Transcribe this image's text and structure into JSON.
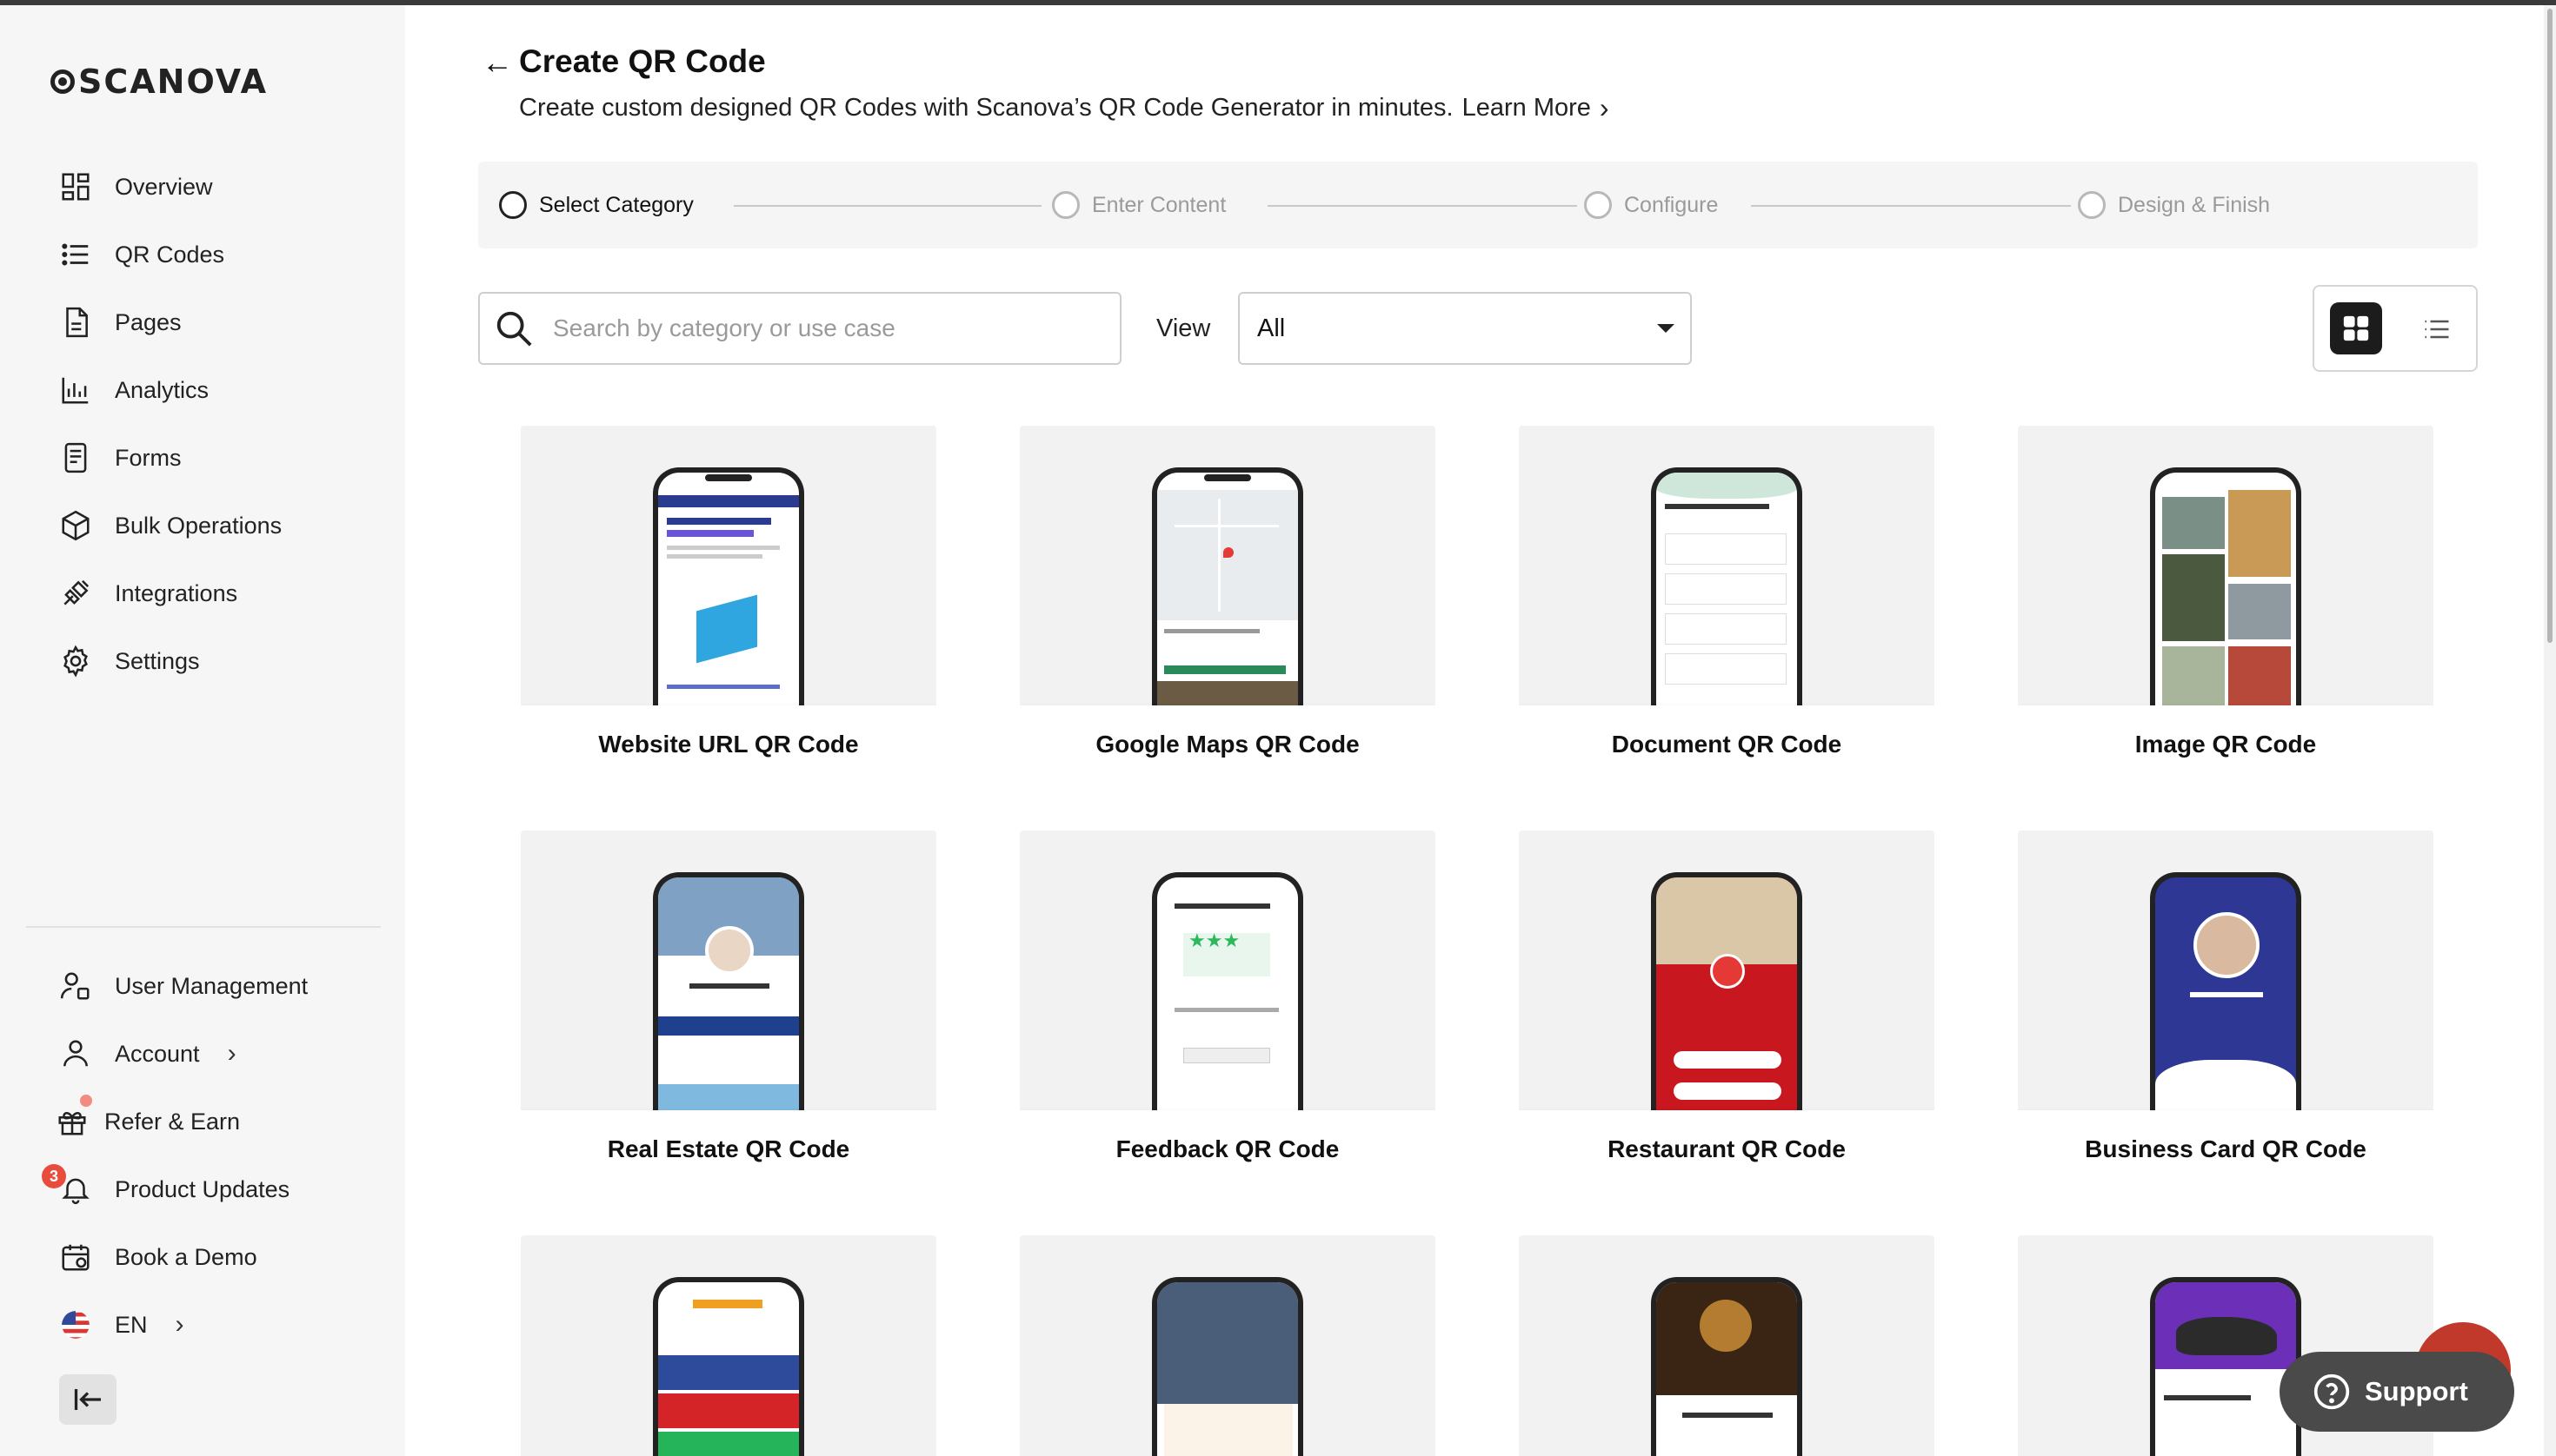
{
  "app": {
    "brand": "SCANOVA"
  },
  "sidebar": {
    "items": [
      {
        "label": "Overview",
        "icon": "overview-icon"
      },
      {
        "label": "QR Codes",
        "icon": "list-icon"
      },
      {
        "label": "Pages",
        "icon": "page-icon"
      },
      {
        "label": "Analytics",
        "icon": "analytics-icon"
      },
      {
        "label": "Forms",
        "icon": "form-icon"
      },
      {
        "label": "Bulk Operations",
        "icon": "cube-icon"
      },
      {
        "label": "Integrations",
        "icon": "plug-icon"
      },
      {
        "label": "Settings",
        "icon": "gear-icon"
      }
    ],
    "bottom_items": [
      {
        "label": "User Management",
        "icon": "user-settings-icon"
      },
      {
        "label": "Account",
        "icon": "user-icon"
      },
      {
        "label": "Refer & Earn",
        "icon": "gift-icon"
      },
      {
        "label": "Product Updates",
        "icon": "bell-icon"
      },
      {
        "label": "Book a Demo",
        "icon": "calendar-icon"
      },
      {
        "label": "EN",
        "icon": "us-flag-icon"
      }
    ],
    "product_updates_count": "3"
  },
  "header": {
    "title": "Create QR Code",
    "subtitle": "Create custom designed QR Codes with Scanova’s QR Code Generator in minutes.",
    "learn_more": "Learn More"
  },
  "stepper": {
    "steps": [
      {
        "label": "Select Category",
        "active": true
      },
      {
        "label": "Enter Content",
        "active": false
      },
      {
        "label": "Configure",
        "active": false
      },
      {
        "label": "Design & Finish",
        "active": false
      }
    ]
  },
  "toolbar": {
    "search_placeholder": "Search by category or use case",
    "view_label": "View",
    "view_selected": "All"
  },
  "cards": [
    {
      "label": "Website URL QR Code"
    },
    {
      "label": "Google Maps QR Code"
    },
    {
      "label": "Document QR Code"
    },
    {
      "label": "Image QR Code"
    },
    {
      "label": "Real Estate QR Code"
    },
    {
      "label": "Feedback QR Code"
    },
    {
      "label": "Restaurant QR Code"
    },
    {
      "label": "Business Card QR Code"
    },
    {
      "label": ""
    },
    {
      "label": ""
    },
    {
      "label": ""
    },
    {
      "label": ""
    }
  ],
  "support": {
    "label": "Support"
  },
  "colors": {
    "accent": "#1c1c1c",
    "badge": "#e74c3c",
    "support_bg": "#4a4a4a"
  }
}
